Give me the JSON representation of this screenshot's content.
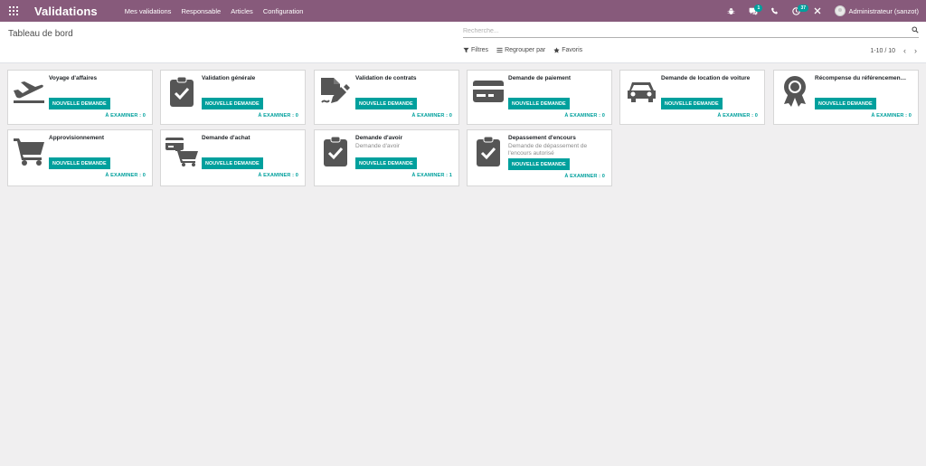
{
  "navbar": {
    "brand": "Validations",
    "menu": [
      "Mes validations",
      "Responsable",
      "Articles",
      "Configuration"
    ],
    "messages_count": "1",
    "activities_count": "37",
    "user": "Administrateur (sanzot)",
    "bg_color": "#875a7b"
  },
  "control_panel": {
    "breadcrumb": "Tableau de bord",
    "search_placeholder": "Recherche...",
    "filters_label": "Filtres",
    "group_by_label": "Regrouper par",
    "favorites_label": "Favoris",
    "pager": "1-10 / 10"
  },
  "accent_color": "#00a09d",
  "cards": [
    {
      "title": "Voyage d'affaires",
      "description": "",
      "button": "NOUVELLE DEMANDE",
      "to_review": "À EXAMINER : 0",
      "icon": "plane-departure-icon"
    },
    {
      "title": "Validation générale",
      "description": "",
      "button": "NOUVELLE DEMANDE",
      "to_review": "À EXAMINER : 0",
      "icon": "clipboard-check-icon"
    },
    {
      "title": "Validation de contrats",
      "description": "",
      "button": "NOUVELLE DEMANDE",
      "to_review": "À EXAMINER : 0",
      "icon": "file-signature-icon"
    },
    {
      "title": "Demande de paiement",
      "description": "",
      "button": "NOUVELLE DEMANDE",
      "to_review": "À EXAMINER : 0",
      "icon": "credit-card-icon"
    },
    {
      "title": "Demande de location de voiture",
      "description": "",
      "button": "NOUVELLE DEMANDE",
      "to_review": "À EXAMINER : 0",
      "icon": "car-icon"
    },
    {
      "title": "Récompense du référencemen…",
      "description": "",
      "button": "NOUVELLE DEMANDE",
      "to_review": "À EXAMINER : 0",
      "icon": "award-icon"
    },
    {
      "title": "Approvisionnement",
      "description": "",
      "button": "NOUVELLE DEMANDE",
      "to_review": "À EXAMINER : 0",
      "icon": "shopping-cart-icon"
    },
    {
      "title": "Demande d'achat",
      "description": "",
      "button": "NOUVELLE DEMANDE",
      "to_review": "À EXAMINER : 0",
      "icon": "cart-card-icon"
    },
    {
      "title": "Demande d'avoir",
      "description": "Demande d'avoir",
      "button": "NOUVELLE DEMANDE",
      "to_review": "À EXAMINER : 1",
      "icon": "clipboard-check-icon"
    },
    {
      "title": "Depassement d'encours",
      "description": "Demande de dépassement de l'encours autorisé",
      "button": "NOUVELLE DEMANDE",
      "to_review": "À EXAMINER : 0",
      "icon": "clipboard-check-icon"
    }
  ]
}
